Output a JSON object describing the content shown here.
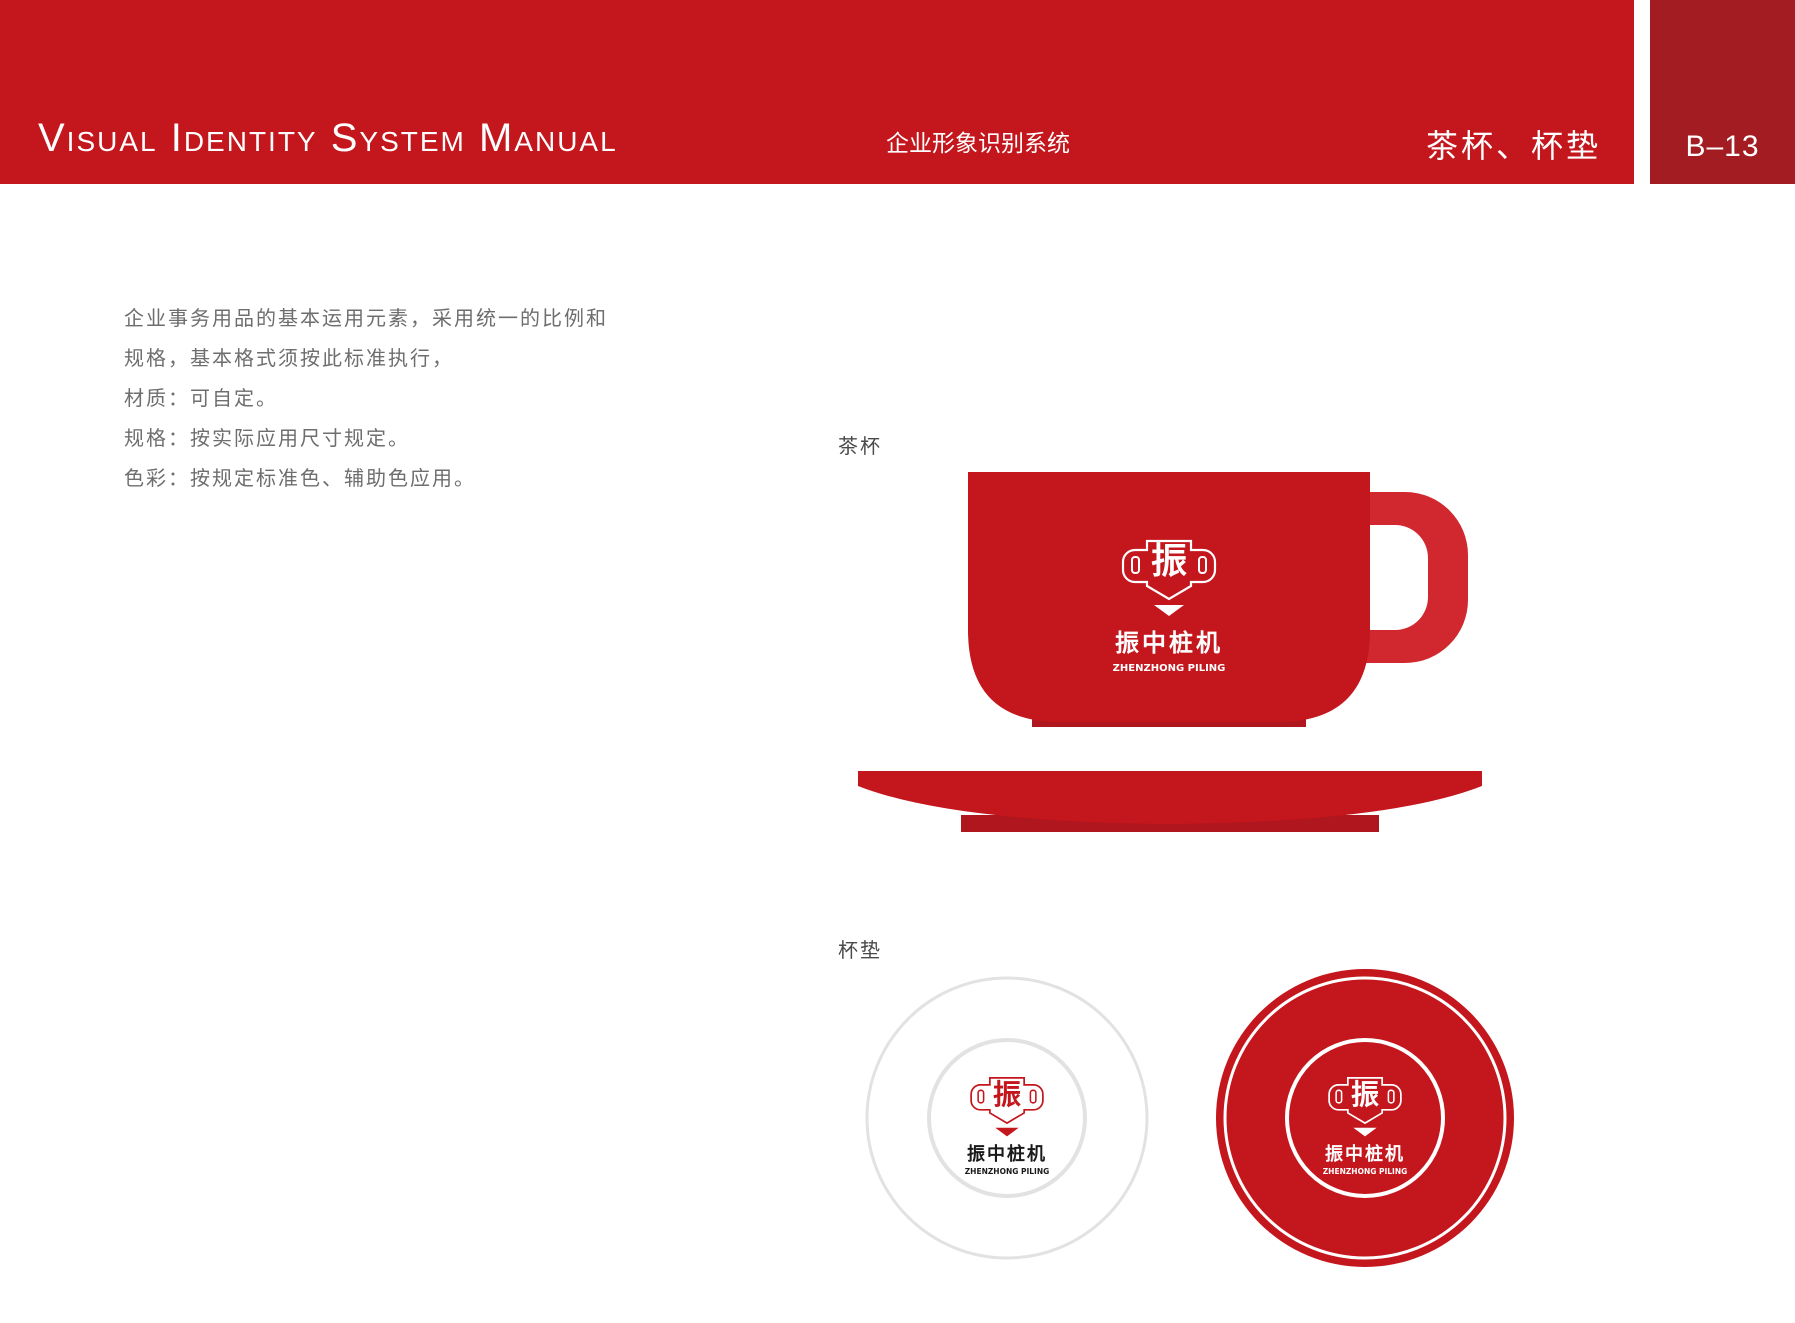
{
  "header": {
    "title": "Visual Identity System Manual",
    "subtitle": "企业形象识别系统",
    "section": "茶杯、杯垫",
    "page": "B–13"
  },
  "description": {
    "lines": [
      "企业事务用品的基本运用元素，采用统一的比例和",
      "规格，基本格式须按此标准执行，",
      "材质：可自定。",
      "规格：按实际应用尺寸规定。",
      "色彩：按规定标准色、辅助色应用。"
    ]
  },
  "cup_section": {
    "label": "茶杯"
  },
  "coaster_section": {
    "label": "杯垫"
  },
  "logo": {
    "glyph": "振",
    "name_cn": "振中桩机",
    "name_en": "ZHENZHONG PILING"
  },
  "colors": {
    "brand_red": "#c4161d",
    "dark_red": "#a31c22",
    "handle_red": "#d1282f",
    "base_red": "#b0161d",
    "coaster_ring_gray": "#e2e2e2",
    "text_gray": "#6e6e6e"
  }
}
